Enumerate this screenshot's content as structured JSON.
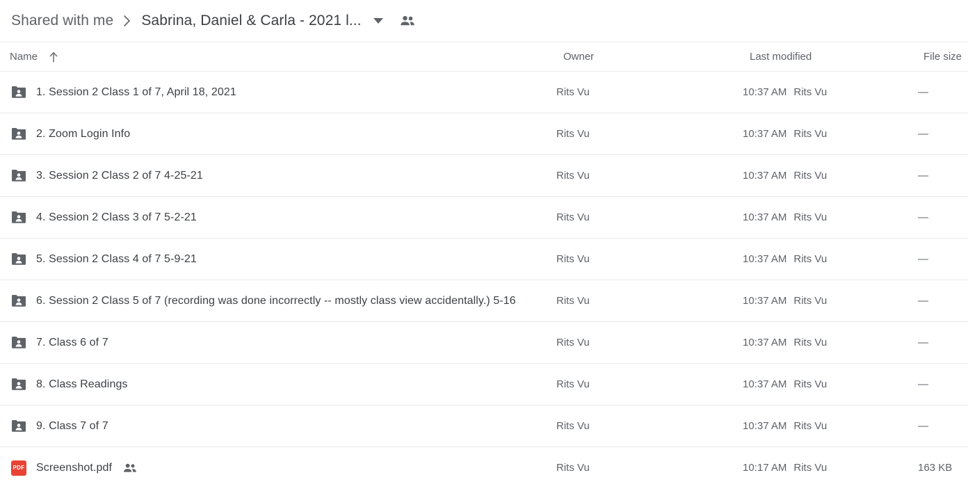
{
  "breadcrumb": {
    "parent": "Shared with me",
    "current": "Sabrina, Daniel & Carla - 2021 l...",
    "separator_icon": "chevron-right-icon",
    "caret_icon": "chevron-down-icon",
    "people_icon": "people-shared-icon"
  },
  "table": {
    "headers": {
      "name": "Name",
      "owner": "Owner",
      "last_modified": "Last modified",
      "file_size": "File size"
    },
    "sort": {
      "column": "Name",
      "direction": "ascending",
      "icon": "arrow-up-icon"
    },
    "rows": [
      {
        "icon": "shared-folder-icon",
        "type": "folder",
        "name": "1. Session 2 Class 1 of 7, April 18, 2021",
        "shared": false,
        "owner": "Rits Vu",
        "modified_time": "10:37 AM",
        "modified_by": "Rits Vu",
        "size": "—"
      },
      {
        "icon": "shared-folder-icon",
        "type": "folder",
        "name": "2. Zoom Login Info",
        "shared": false,
        "owner": "Rits Vu",
        "modified_time": "10:37 AM",
        "modified_by": "Rits Vu",
        "size": "—"
      },
      {
        "icon": "shared-folder-icon",
        "type": "folder",
        "name": "3. Session 2 Class 2 of 7 4-25-21",
        "shared": false,
        "owner": "Rits Vu",
        "modified_time": "10:37 AM",
        "modified_by": "Rits Vu",
        "size": "—"
      },
      {
        "icon": "shared-folder-icon",
        "type": "folder",
        "name": "4. Session 2 Class 3 of 7 5-2-21",
        "shared": false,
        "owner": "Rits Vu",
        "modified_time": "10:37 AM",
        "modified_by": "Rits Vu",
        "size": "—"
      },
      {
        "icon": "shared-folder-icon",
        "type": "folder",
        "name": "5. Session 2 Class 4 of 7 5-9-21",
        "shared": false,
        "owner": "Rits Vu",
        "modified_time": "10:37 AM",
        "modified_by": "Rits Vu",
        "size": "—"
      },
      {
        "icon": "shared-folder-icon",
        "type": "folder",
        "name": "6. Session 2 Class 5 of 7 (recording was done incorrectly -- mostly class view accidentally.) 5-16",
        "shared": false,
        "owner": "Rits Vu",
        "modified_time": "10:37 AM",
        "modified_by": "Rits Vu",
        "size": "—"
      },
      {
        "icon": "shared-folder-icon",
        "type": "folder",
        "name": "7. Class 6 of 7",
        "shared": false,
        "owner": "Rits Vu",
        "modified_time": "10:37 AM",
        "modified_by": "Rits Vu",
        "size": "—"
      },
      {
        "icon": "shared-folder-icon",
        "type": "folder",
        "name": "8. Class Readings",
        "shared": false,
        "owner": "Rits Vu",
        "modified_time": "10:37 AM",
        "modified_by": "Rits Vu",
        "size": "—"
      },
      {
        "icon": "shared-folder-icon",
        "type": "folder",
        "name": "9. Class 7 of 7",
        "shared": false,
        "owner": "Rits Vu",
        "modified_time": "10:37 AM",
        "modified_by": "Rits Vu",
        "size": "—"
      },
      {
        "icon": "pdf-file-icon",
        "type": "pdf",
        "badge_label": "PDF",
        "name": "Screenshot.pdf",
        "shared": true,
        "owner": "Rits Vu",
        "modified_time": "10:17 AM",
        "modified_by": "Rits Vu",
        "size": "163 KB"
      }
    ]
  },
  "colors": {
    "pdf_red": "#ea4335",
    "folder_gray": "#5f6368",
    "text_primary": "#3c4043",
    "text_secondary": "#5f6368",
    "divider": "#e8eaed"
  }
}
